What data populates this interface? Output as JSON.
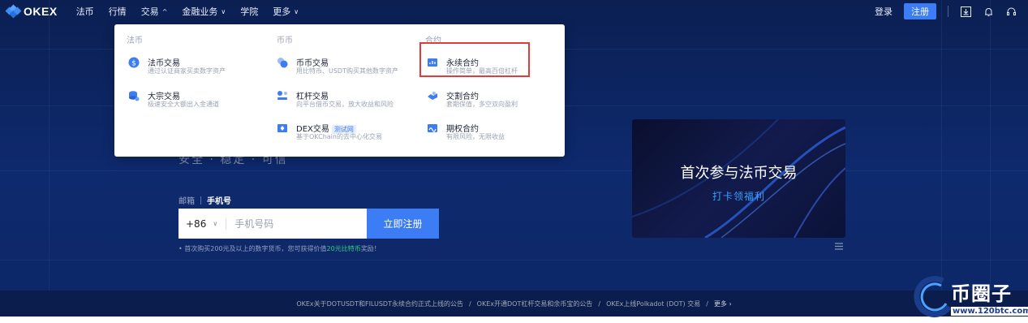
{
  "nav": {
    "logo": "OKEX",
    "items": [
      {
        "label": "法币"
      },
      {
        "label": "行情"
      },
      {
        "label": "交易",
        "chevron": "^"
      },
      {
        "label": "金融业务",
        "chevron": "∨"
      },
      {
        "label": "学院"
      },
      {
        "label": "更多",
        "chevron": "∨"
      }
    ],
    "login": "登录",
    "register": "注册"
  },
  "dropdown": {
    "columns": [
      {
        "title": "法币",
        "items": [
          {
            "name": "法币交易",
            "desc": "通过认证商家买卖数字资产"
          },
          {
            "name": "大宗交易",
            "desc": "极速安全大额出入金通道"
          }
        ]
      },
      {
        "title": "币币",
        "items": [
          {
            "name": "币币交易",
            "desc": "用比特币、USDT购买其他数字资产"
          },
          {
            "name": "杠杆交易",
            "desc": "向平台借币交易，放大收益和风险"
          },
          {
            "name": "DEX交易",
            "tag": "测试网",
            "desc": "基于OKChain的去中心化交易"
          }
        ]
      },
      {
        "title": "合约",
        "items": [
          {
            "name": "永续合约",
            "desc": "操作简单，最高百倍杠杆"
          },
          {
            "name": "交割合约",
            "desc": "套期保值，多空双向盈利"
          },
          {
            "name": "期权合约",
            "desc": "有限风险，无限收益"
          }
        ]
      }
    ]
  },
  "hero": {
    "subtitle": "安全 · 稳定 · 可信",
    "tab_email": "邮箱",
    "tab_phone": "手机号",
    "country_code": "+86",
    "phone_placeholder": "手机号码",
    "submit": "立即注册",
    "promo_prefix": "• 首次购买200元及以上的数字货币，您可获得价值",
    "promo_highlight": "20元比特币",
    "promo_suffix": "奖励！"
  },
  "banner": {
    "title": "首次参与法币交易",
    "subtitle": "打卡领福利"
  },
  "announcements": {
    "items": [
      "OKEx关于DOTUSDT和FILUSDT永续合约正式上线的公告",
      "OKEx开通DOT杠杆交易和余币宝的公告",
      "OKEx上线Polkadot (DOT) 交易"
    ],
    "separator": "/",
    "more": "更多 ›"
  },
  "watermark": {
    "text": "币圈子",
    "url": "www.120btc.com"
  },
  "colors": {
    "accent": "#3c7cf5",
    "highlight_border": "#e33a3a",
    "promo_green": "#2fd07d"
  }
}
